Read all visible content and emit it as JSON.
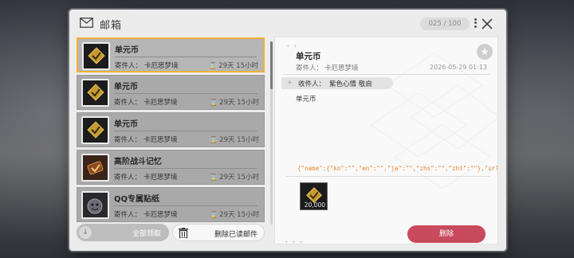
{
  "header": {
    "title": "邮箱",
    "count": "025 / 100"
  },
  "colors": {
    "selected_border": "#f0b232",
    "delete_button": "#c84a5c",
    "json_text": "#e8842e"
  },
  "mail_list": [
    {
      "title": "单元币",
      "sender_label": "寄件人：",
      "sender": "卡厄思梦境",
      "time_left": "29天 15小时",
      "icon": "coin-item-icon",
      "selected": true
    },
    {
      "title": "单元币",
      "sender_label": "寄件人：",
      "sender": "卡厄思梦境",
      "time_left": "29天 15小时",
      "icon": "coin-item-icon",
      "selected": false
    },
    {
      "title": "单元币",
      "sender_label": "寄件人：",
      "sender": "卡厄思梦境",
      "time_left": "29天 15小时",
      "icon": "coin-item-icon",
      "selected": false
    },
    {
      "title": "高阶战斗记忆",
      "sender_label": "寄件人：",
      "sender": "卡厄思梦境",
      "time_left": "29天 15小时",
      "icon": "battle-memory-icon",
      "selected": false
    },
    {
      "title": "QQ专属贴纸",
      "sender_label": "寄件人：",
      "sender": "卡厄思梦境",
      "time_left": "29天 15小时",
      "icon": "sticker-icon",
      "selected": false
    }
  ],
  "buttons": {
    "claim_all": "全部领取",
    "delete_read": "删除已读邮件",
    "delete": "删除"
  },
  "detail": {
    "title": "单元币",
    "sender_label": "寄件人：",
    "sender": "卡厄思梦境",
    "date": "2026-05-29 01:13",
    "recipient_label": "收件人：",
    "recipient": "紫色心情 敬启",
    "body": "单元币",
    "json_text": "{\"name\":{\"ko\":\"\",\"en\":\"\",\"ja\":\"\",\"zhs\":\"\",\"zht\":\"\"},\"url\":{\"ko\":\"\",\"en\":\"\",\"ja\":\"\",\"zhs\":\"\",\"",
    "attachment_qty": "20,000"
  }
}
